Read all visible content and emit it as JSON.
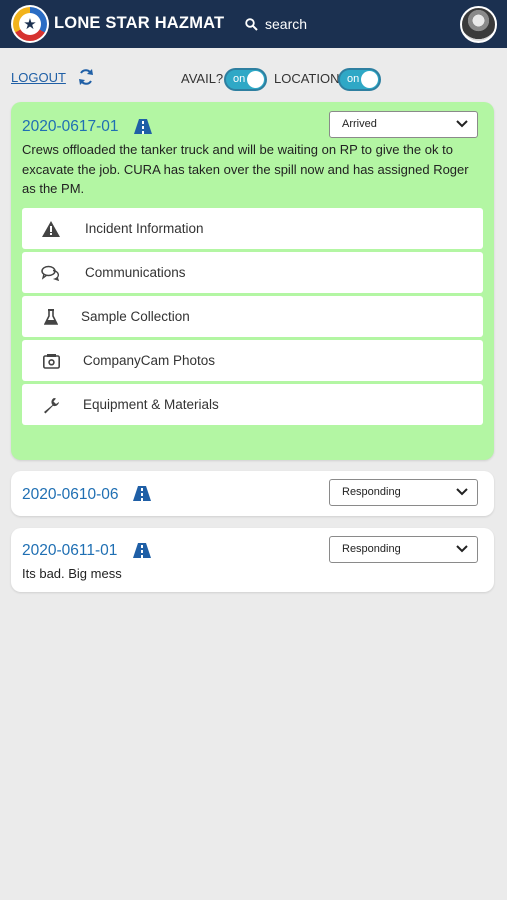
{
  "header": {
    "brand": "LONE STAR HAZMAT",
    "search_label": "search"
  },
  "controls": {
    "logout": "LOGOUT",
    "avail_label": "AVAIL?",
    "avail_toggle": "on",
    "location_label": "LOCATION",
    "location_toggle": "on"
  },
  "incidents": [
    {
      "id": "2020-0617-01",
      "status": "Arrived",
      "description": "Crews offloaded the tanker truck and will be waiting on RP to give the ok to excavate the job. CURA has taken over the spill now and has assigned Roger as the PM.",
      "menu": [
        {
          "label": "Incident Information",
          "icon": "warning-icon"
        },
        {
          "label": "Communications",
          "icon": "chat-icon"
        },
        {
          "label": "Sample Collection",
          "icon": "flask-icon"
        },
        {
          "label": "CompanyCam Photos",
          "icon": "camera-icon"
        },
        {
          "label": "Equipment & Materials",
          "icon": "wrench-icon"
        }
      ]
    },
    {
      "id": "2020-0610-06",
      "status": "Responding",
      "description": ""
    },
    {
      "id": "2020-0611-01",
      "status": "Responding",
      "description": "Its bad. Big mess"
    }
  ],
  "colors": {
    "header_bg": "#1b3050",
    "active_card": "#b3f6a3",
    "link": "#1f6fb3",
    "toggle": "#2fa8c6"
  }
}
